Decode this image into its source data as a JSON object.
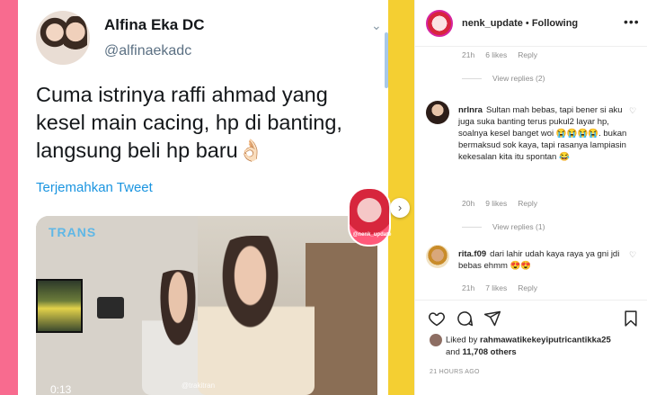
{
  "tweet": {
    "name": "Alfina Eka DC",
    "handle": "@alfinaekadc",
    "text": "Cuma istrinya raffi ahmad yang kesel main cacing, hp di banting, langsung beli hp baru👌🏻",
    "translate": "Terjemahkan Tweet",
    "chevron": "⌄"
  },
  "video": {
    "channel_logo": "TRANS",
    "time": "0:13",
    "watermark": "@trakitran",
    "sticker_label": "@nenk_update"
  },
  "instagram": {
    "username": "nenk_update",
    "separator": " • ",
    "following": "Following",
    "more": "•••",
    "top_meta": {
      "time": "21h",
      "likes": "6 likes",
      "reply": "Reply"
    },
    "top_view_replies": "View replies (2)",
    "comments": [
      {
        "user": "nrlnra",
        "text": "Sultan mah bebas, tapi bener si aku juga suka banting terus pukul2 layar hp, soalnya kesel banget woi 😭😭😭😭. bukan bermaksud sok kaya, tapi rasanya lampiasin kekesalan kita itu spontan 😂",
        "time": "20h",
        "likes": "9 likes",
        "reply": "Reply",
        "view_replies": "View replies (1)"
      },
      {
        "user": "rita.f09",
        "text": "dari lahir udah kaya raya ya gni jdi bebas ehmm 😍😍",
        "time": "21h",
        "likes": "7 likes",
        "reply": "Reply"
      }
    ],
    "liked_prefix": "Liked by ",
    "liked_user": "rahmawatikekeyiputricantikka25",
    "liked_and": "and ",
    "liked_count": "11,708 others",
    "timestamp": "21 HOURS AGO"
  },
  "icons": {
    "heart": "heart-icon",
    "comment": "comment-icon",
    "share": "share-icon",
    "bookmark": "bookmark-icon",
    "next": "chevron-right-icon"
  },
  "colors": {
    "link_blue": "#1b95e0",
    "pink_strip": "#f86b8f",
    "yellow_strip": "#f4cf32"
  }
}
